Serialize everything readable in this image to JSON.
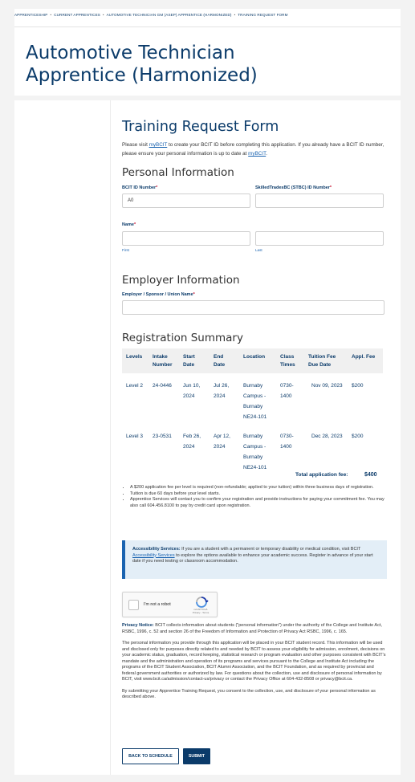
{
  "breadcrumb": [
    "APPRENTICESHIP",
    "CURRENT APPRENTICES",
    "AUTOMOTIVE TECHNICIAN GM (ASEP) APPRENTICE (HARMONIZED)",
    "TRAINING REQUEST FORM"
  ],
  "page_title": "Automotive Technician Apprentice (Harmonized)",
  "form": {
    "title": "Training Request Form",
    "intro": {
      "t1": "Please visit ",
      "link1": "myBCIT",
      "t2": " to create your BCIT ID before completing this application.  If you already have a BCIT ID number, please ensure your personal information is up to date at ",
      "link2": "myBCIT",
      "t3": "."
    }
  },
  "personal": {
    "heading": "Personal Information",
    "bcit_id_label": "BCIT ID Number",
    "bcit_id_value": "A0",
    "stbc_label": "SkilledTradesBC (STBC) ID Number",
    "stbc_value": "",
    "name_label": "Name",
    "first_sub": "First",
    "last_sub": "Last",
    "required_mark": "*"
  },
  "employer": {
    "heading": "Employer Information",
    "label": "Employer / Sponsor / Union Name",
    "value": ""
  },
  "registration": {
    "heading": "Registration Summary",
    "columns": [
      "Levels",
      "Intake Number",
      "Start Date",
      "End Date",
      "Location",
      "Class Times",
      "Tuition Fee Due Date",
      "Appl. Fee"
    ],
    "rows": [
      [
        "Level 2",
        "24-0446",
        "Jun 10, 2024",
        "Jul 26, 2024",
        "Burnaby Campus - Burnaby NE24-101",
        "0730-1400",
        "Nov 09, 2023",
        "$200"
      ],
      [
        "Level 3",
        "23-0531",
        "Feb 26, 2024",
        "Apr 12, 2024",
        "Burnaby Campus - Burnaby NE24-101",
        "0730-1400",
        "Dec 28, 2023",
        "$200"
      ]
    ],
    "total_label": "Total application fee:",
    "total_value": "$400",
    "notes": [
      "A $200 application fee per level is required (non-refundable; applied to your tuition) within three business days of registration.",
      "Tuition is due 60 days before your level starts.",
      "Apprentice Services will contact you to confirm your registration and provide instructions for paying your commitment fee. You may also call 604.456.8100 to pay by credit card upon registration."
    ]
  },
  "accessibility": {
    "bold": "Accessibility Services:",
    "t1": " If you are a student with a permanent or temporary disability or medical condition, visit BCIT ",
    "link": "Accessibility Services",
    "t2": " to explore the options available to enhance your academic success. Register in advance of your start date if you need testing or classroom accommodation."
  },
  "captcha": {
    "label": "I'm not a robot",
    "brand": "reCAPTCHA",
    "terms": "Privacy - Terms"
  },
  "privacy": {
    "bold": "Privacy Notice:",
    "p1": " BCIT collects information about students (\"personal information\") under the authority of the College and Institute Act, RSBC, 1996, c. 52 and section 26 of the Freedom of Information and Protection of Privacy Act RSBC, 1996, c. 165.",
    "p2": "The personal information you provide through this application will be placed in your BCIT student record. This information will be used and disclosed only for purposes directly related to and needed by BCIT to assess your eligibility for admission, enrolment, decisions on your academic status, graduation, record keeping, statistical research or program evaluation and other purposes consistent with BCIT's mandate and the administration and operation of its programs and services pursuant to the College and Institute Act including the programs of the BCIT Student Association, BCIT Alumni Association, and the BCIT Foundation, and as required by provincial and federal government authorities or authorized by law. For questions about the collection, use and disclosure of personal information by BCIT, visit www.bcit.ca/admission/contact-us/privacy or contact the Privacy Office at 604-432-8508 or privacy@bcit.ca.",
    "p3": "By submitting your Apprentice Training Request, you consent to the collection, use, and disclosure of your personal information as described above."
  },
  "buttons": {
    "back": "BACK TO SCHEDULE",
    "submit": "SUBMIT"
  },
  "colors": {
    "brand": "#0b3b6a",
    "link": "#1a63b0",
    "required": "#c8102e",
    "info_bg": "#e3eef7"
  }
}
